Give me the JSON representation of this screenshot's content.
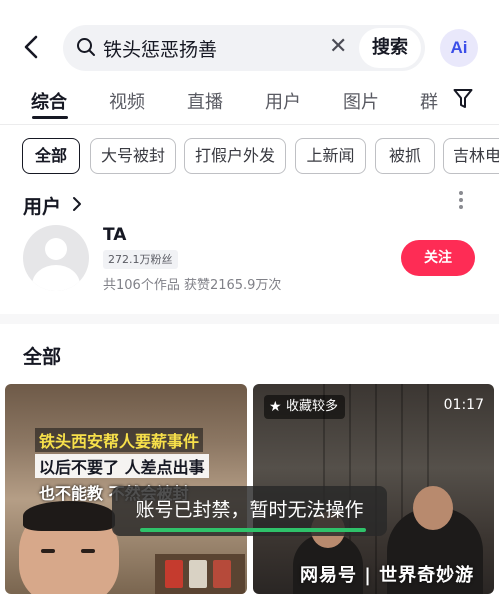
{
  "search": {
    "query": "铁头惩恶扬善",
    "button_label": "搜索",
    "ai_label": "Ai"
  },
  "tabs": [
    {
      "label": "综合",
      "active": true
    },
    {
      "label": "视频"
    },
    {
      "label": "直播"
    },
    {
      "label": "用户"
    },
    {
      "label": "图片"
    },
    {
      "label": "群"
    }
  ],
  "chips": [
    {
      "label": "全部",
      "active": true
    },
    {
      "label": "大号被封"
    },
    {
      "label": "打假户外发"
    },
    {
      "label": "上新闻"
    },
    {
      "label": "被抓"
    },
    {
      "label": "吉林电"
    }
  ],
  "user_section": {
    "title": "用户",
    "user": {
      "name": "TA",
      "fans": "272.1万粉丝",
      "stats": "共106个作品 获赞2165.9万次",
      "follow_label": "关注"
    }
  },
  "all_section": {
    "title": "全部"
  },
  "videos": [
    {
      "overlay_lines": [
        "铁头西安帮人要薪事件",
        "以后不要了 人差点出事",
        "也不能教 不然会被封"
      ]
    },
    {
      "badge": "收藏较多",
      "duration": "01:17",
      "watermark": "网易号 | 世界奇妙游"
    }
  ],
  "toast": {
    "text": "账号已封禁，暂时无法操作"
  },
  "colors": {
    "accent": "#fe2c55",
    "toast_bar": "#2fc26a",
    "ai": "#3b4ee8"
  }
}
